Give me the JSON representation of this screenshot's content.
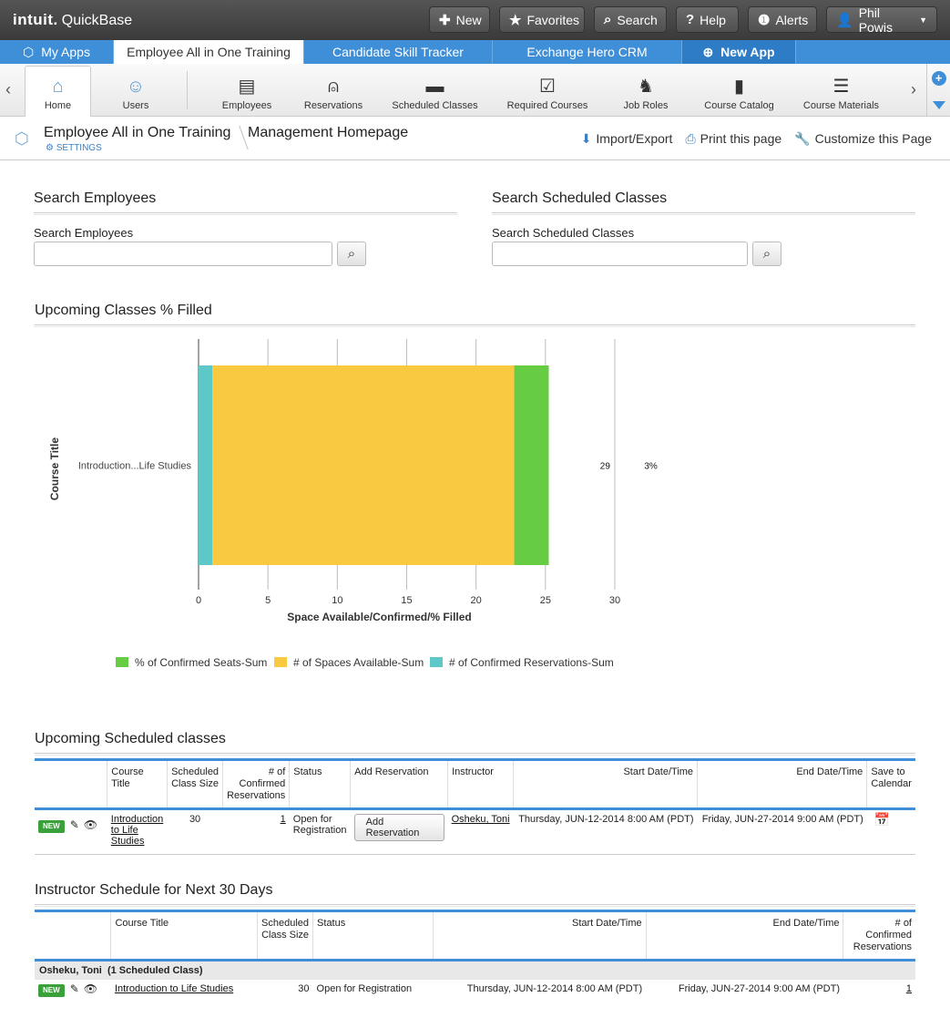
{
  "top": {
    "logo": "intuit.",
    "product": "QuickBase",
    "buttons": [
      {
        "label": "New",
        "icon": "plus-icon"
      },
      {
        "label": "Favorites",
        "icon": "star-icon"
      },
      {
        "label": "Search",
        "icon": "search-icon"
      },
      {
        "label": "Help",
        "icon": "help-icon"
      },
      {
        "label": "Alerts",
        "icon": "alert-icon"
      },
      {
        "label": "Phil Powis",
        "icon": "user-icon"
      }
    ]
  },
  "apps": {
    "my_apps": "My Apps",
    "tabs": [
      "Employee All in One Training",
      "Candidate Skill Tracker",
      "Exchange Hero CRM"
    ],
    "new_app": "New App"
  },
  "nav": {
    "items": [
      "Home",
      "Users",
      "Employees",
      "Reservations",
      "Scheduled Classes",
      "Required Courses",
      "Job Roles",
      "Course Catalog",
      "Course Materials"
    ]
  },
  "crumb": {
    "app": "Employee All in One Training",
    "settings": "SETTINGS",
    "page": "Management Homepage",
    "import": "Import/Export",
    "print": "Print this page",
    "customize": "Customize this Page"
  },
  "search_emp": {
    "title": "Search Employees",
    "label": "Search Employees",
    "placeholder": ""
  },
  "search_cls": {
    "title": "Search Scheduled Classes",
    "label": "Search Scheduled Classes",
    "placeholder": ""
  },
  "chart_title": "Upcoming Classes % Filled",
  "chart_data": {
    "type": "bar",
    "orientation": "horizontal-stacked",
    "categories": [
      "Introduction...Life Studies"
    ],
    "series": [
      {
        "name": "# of Confirmed Reservations-Sum",
        "values": [
          1
        ],
        "color": "#5ec7c7"
      },
      {
        "name": "# of Spaces Available-Sum",
        "values": [
          29
        ],
        "color": "#f9c940"
      },
      {
        "name": "% of Confirmed Seats-Sum",
        "values": [
          3
        ],
        "color": "#66cc44"
      }
    ],
    "data_labels": [
      "29",
      "3%"
    ],
    "xlabel": "Space Available/Confirmed/% Filled",
    "ylabel": "Course Title",
    "xlim": [
      0,
      30
    ],
    "xticks": [
      "0",
      "5",
      "10",
      "15",
      "20",
      "25",
      "30"
    ],
    "legend_position": "bottom",
    "grid": true
  },
  "legend_order": [
    "% of Confirmed Seats-Sum",
    "# of Spaces Available-Sum",
    "# of Confirmed Reservations-Sum"
  ],
  "upcoming": {
    "title": "Upcoming Scheduled classes",
    "headers": [
      "Course Title",
      "Scheduled Class Size",
      "# of Confirmed Reservations",
      "Status",
      "Add Reservation",
      "Instructor",
      "Start Date/Time",
      "End Date/Time",
      "Save to Calendar"
    ],
    "row": {
      "badge": "NEW",
      "course": "Introduction to Life Studies",
      "size": "30",
      "confirmed": "1",
      "status": "Open for Registration",
      "add": "Add  Reservation",
      "instructor": "Osheku, Toni",
      "start": "Thursday, JUN-12-2014  8:00 AM (PDT)",
      "end": "Friday, JUN-27-2014  9:00 AM (PDT)"
    }
  },
  "instructor": {
    "title": "Instructor Schedule for Next 30 Days",
    "headers": [
      "Course Title",
      "Scheduled Class Size",
      "Status",
      "Start Date/Time",
      "End Date/Time",
      "# of Confirmed Reservations"
    ],
    "group": "Osheku, Toni  (1 Scheduled Class)",
    "row": {
      "badge": "NEW",
      "course": "Introduction to Life Studies",
      "size": "30",
      "status": "Open for Registration",
      "start": "Thursday, JUN-12-2014  8:00 AM (PDT)",
      "end": "Friday, JUN-27-2014  9:00 AM (PDT)",
      "confirmed": "1"
    }
  }
}
